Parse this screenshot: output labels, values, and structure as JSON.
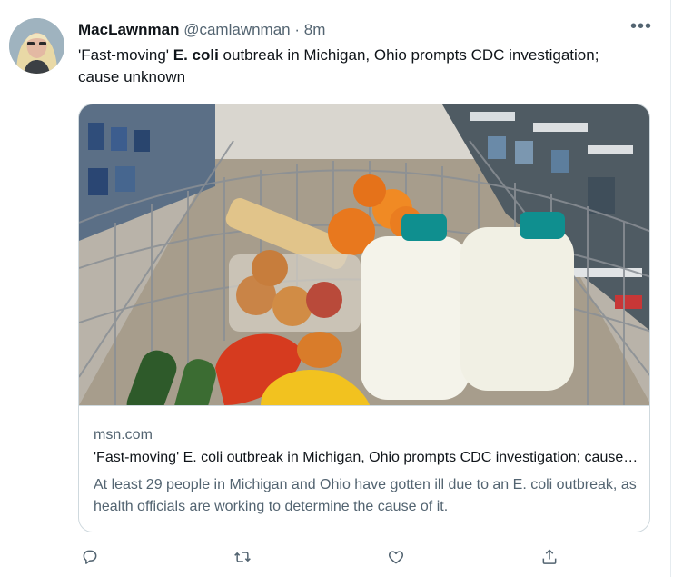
{
  "tweet": {
    "display_name": "MacLawnman",
    "handle": "@camlawnman",
    "separator": "·",
    "time": "8m",
    "more_label": "•••",
    "text_prefix": "'Fast-moving' ",
    "text_bold": "E. coli",
    "text_suffix": " outbreak in Michigan, Ohio prompts CDC investigation; cause unknown"
  },
  "card": {
    "domain": "msn.com",
    "title": "'Fast-moving' E. coli outbreak in Michigan, Ohio prompts CDC investigation; cause unknown",
    "description": "At least 29 people in Michigan and Ohio have gotten ill due to an E. coli outbreak, as health officials are working to determine the cause of it."
  },
  "actions": [
    "reply-icon",
    "retweet-icon",
    "like-icon",
    "share-icon"
  ],
  "colors": {
    "text": "#0f1419",
    "secondary": "#536471",
    "border": "#cfd9de"
  }
}
